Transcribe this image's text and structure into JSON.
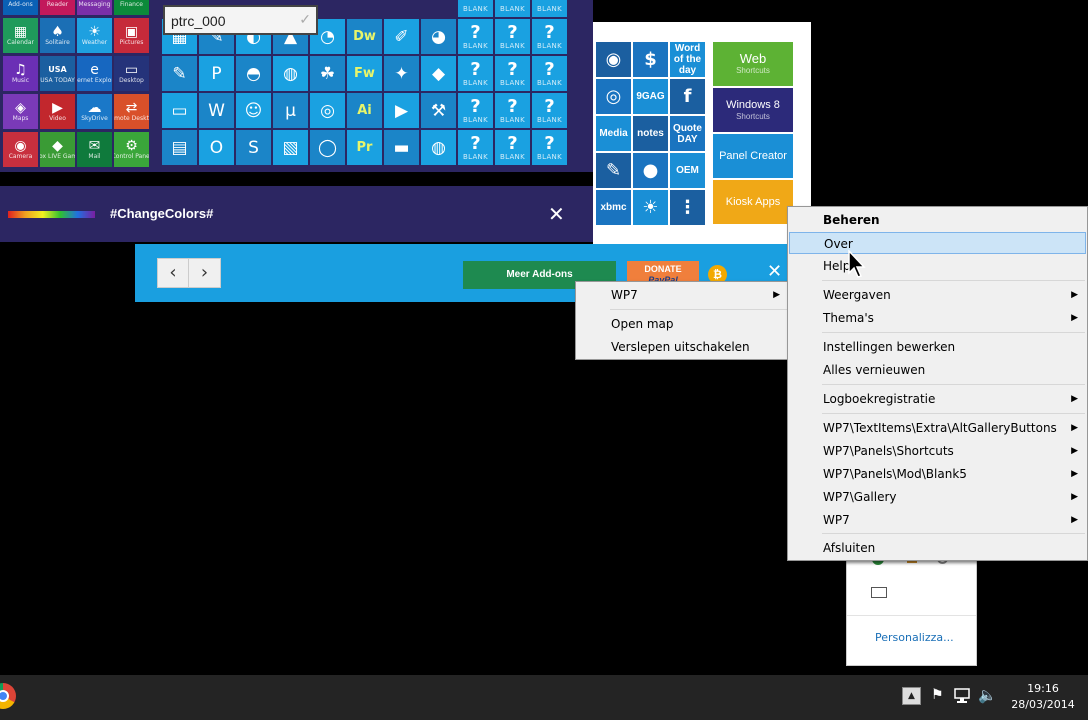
{
  "start": {
    "colors": {
      "accent_bg": "#2c2662",
      "tile_blue": "#1aa1e1",
      "tile_dark": "#1b5fa0"
    },
    "left_tiles": [
      {
        "label": "Add-ons",
        "glyph": "☰",
        "color": "#0a60b5"
      },
      {
        "label": "Reader",
        "glyph": "▤",
        "color": "#c2185b"
      },
      {
        "label": "Messaging",
        "glyph": "✉",
        "color": "#7b2fa8"
      },
      {
        "label": "Finance",
        "glyph": "▲",
        "color": "#0c8a3a"
      },
      {
        "label": "Calendar",
        "glyph": "▦",
        "color": "#1f9a5b"
      },
      {
        "label": "Solitaire",
        "glyph": "♠",
        "color": "#1b6fb5"
      },
      {
        "label": "Weather",
        "glyph": "☀",
        "color": "#1ea0e0"
      },
      {
        "label": "Pictures",
        "glyph": "▣",
        "color": "#c62a3a"
      },
      {
        "label": "Music",
        "glyph": "♫",
        "color": "#6b2fb5"
      },
      {
        "label": "USA TODAY",
        "glyph": "USA",
        "color": "#1b5fa0"
      },
      {
        "label": "Internet Explorer",
        "glyph": "e",
        "color": "#1767c0"
      },
      {
        "label": "Desktop",
        "glyph": "▭",
        "color": "#25337a"
      },
      {
        "label": "Maps",
        "glyph": "◈",
        "color": "#7a3ab8"
      },
      {
        "label": "Video",
        "glyph": "▶",
        "color": "#c2272d"
      },
      {
        "label": "SkyDrive",
        "glyph": "☁",
        "color": "#1a78c8"
      },
      {
        "label": "Remote Desktop",
        "glyph": "⇄",
        "color": "#d9502a"
      },
      {
        "label": "Camera",
        "glyph": "◉",
        "color": "#c82f3e"
      },
      {
        "label": "Xbox LIVE Games",
        "glyph": "◆",
        "color": "#3a9b35"
      },
      {
        "label": "Mail",
        "glyph": "✉",
        "color": "#0f7a3c"
      },
      {
        "label": "Control Panel",
        "glyph": "⚙",
        "color": "#3aa63a"
      }
    ],
    "user_field": "ptrc_000",
    "icon_grid": [
      [
        "▦",
        "✎",
        "◐",
        "▲",
        "◔",
        "Dw",
        "✐",
        "◕"
      ],
      [
        "✎",
        "P",
        "◓",
        "◍",
        "☘",
        "Fw",
        "✦",
        "◆"
      ],
      [
        "▭",
        "W",
        "☺",
        "μ",
        "◎",
        "Ai",
        "▶",
        "⚒"
      ],
      [
        "▤",
        "O",
        "S",
        "▧",
        "◯",
        "Pr",
        "▬",
        "◍"
      ]
    ],
    "blank_label": "BLANK",
    "blank_glyph": "?",
    "mid_tiles": [
      {
        "label": "",
        "glyph": "◉"
      },
      {
        "label": "",
        "glyph": "$"
      },
      {
        "label": "Word of the day",
        "glyph": ""
      },
      {
        "label": "",
        "glyph": "◎"
      },
      {
        "label": "9GAG",
        "glyph": ""
      },
      {
        "label": "",
        "glyph": "f"
      },
      {
        "label": "Media",
        "glyph": ""
      },
      {
        "label": "notes",
        "glyph": ""
      },
      {
        "label": "Quote DAY",
        "glyph": ""
      },
      {
        "label": "",
        "glyph": "✎"
      },
      {
        "label": "",
        "glyph": "●"
      },
      {
        "label": "OEM",
        "glyph": ""
      },
      {
        "label": "xbmc",
        "glyph": ""
      },
      {
        "label": "",
        "glyph": "☀"
      },
      {
        "label": "",
        "glyph": "⋮"
      }
    ],
    "big_tiles": [
      {
        "title": "Web",
        "sub": "Shortcuts",
        "color": "#5db234"
      },
      {
        "title": "Windows 8",
        "sub": "Shortcuts",
        "color": "#2c2a7a"
      },
      {
        "title": "Panel Creator",
        "sub": "",
        "color": "#1a8fd6"
      },
      {
        "title": "Kiosk Apps",
        "sub": "",
        "color": "#f0a817"
      }
    ],
    "change_colors_label": "#ChangeColors#",
    "close_glyph": "✕"
  },
  "addon_bar": {
    "prev_glyph": "‹",
    "next_glyph": "›",
    "meer_label": "Meer Add-ons",
    "donate_label": "DONATE",
    "paypal_label": "PayPal",
    "bitcoin_glyph": "₿",
    "close_glyph": "✕"
  },
  "submenu": {
    "items": [
      {
        "label": "WP7",
        "arrow": true
      },
      {
        "label": "Open map",
        "arrow": false
      },
      {
        "label": "Verslepen uitschakelen",
        "arrow": false
      }
    ],
    "arrow_glyph": "▶"
  },
  "context_menu": {
    "header": "Beheren",
    "items": [
      {
        "label": "Over",
        "arrow": false,
        "highlighted": true
      },
      {
        "label": "Help",
        "arrow": false
      },
      {
        "label": "Weergaven",
        "arrow": true
      },
      {
        "label": "Thema's",
        "arrow": true
      },
      {
        "label": "Instellingen bewerken",
        "arrow": false
      },
      {
        "label": "Alles vernieuwen",
        "arrow": false
      },
      {
        "label": "Logboekregistratie",
        "arrow": true
      },
      {
        "label": "WP7\\TextItems\\Extra\\AltGalleryButtons",
        "arrow": true
      },
      {
        "label": "WP7\\Panels\\Shortcuts",
        "arrow": true
      },
      {
        "label": "WP7\\Panels\\Mod\\Blank5",
        "arrow": true
      },
      {
        "label": "WP7\\Gallery",
        "arrow": true
      },
      {
        "label": "WP7",
        "arrow": true
      },
      {
        "label": "Afsluiten",
        "arrow": false
      }
    ],
    "arrow_glyph": "▶",
    "highlight_color": "#cce4f7"
  },
  "tray_popup": {
    "personalize_label": "Personalizza..."
  },
  "taskbar": {
    "time": "19:16",
    "date": "28/03/2014",
    "icons": [
      "chrome-icon",
      "show-hidden-icons-icon",
      "action-center-flag-icon",
      "network-icon",
      "volume-icon"
    ]
  }
}
